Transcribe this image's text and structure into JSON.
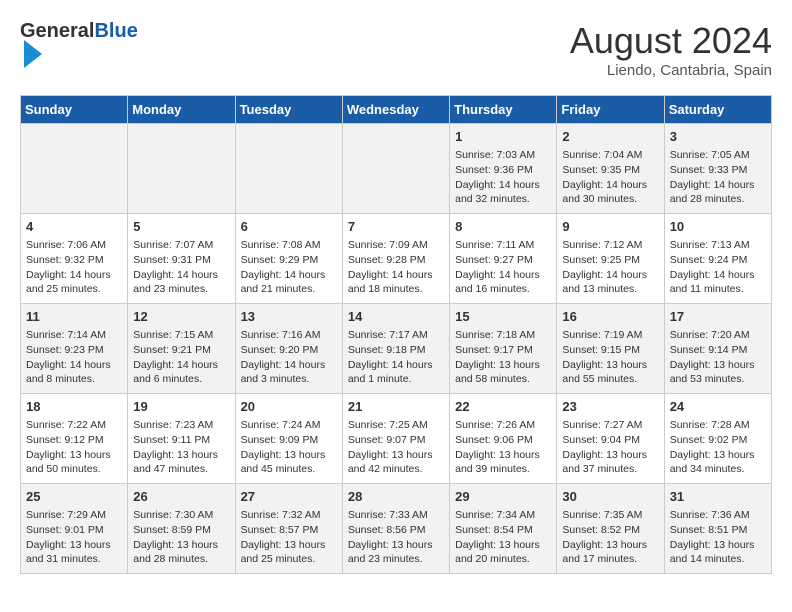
{
  "logo": {
    "general": "General",
    "blue": "Blue"
  },
  "title": "August 2024",
  "location": "Liendo, Cantabria, Spain",
  "days_of_week": [
    "Sunday",
    "Monday",
    "Tuesday",
    "Wednesday",
    "Thursday",
    "Friday",
    "Saturday"
  ],
  "weeks": [
    [
      {
        "day": "",
        "info": ""
      },
      {
        "day": "",
        "info": ""
      },
      {
        "day": "",
        "info": ""
      },
      {
        "day": "",
        "info": ""
      },
      {
        "day": "1",
        "info": "Sunrise: 7:03 AM\nSunset: 9:36 PM\nDaylight: 14 hours and 32 minutes."
      },
      {
        "day": "2",
        "info": "Sunrise: 7:04 AM\nSunset: 9:35 PM\nDaylight: 14 hours and 30 minutes."
      },
      {
        "day": "3",
        "info": "Sunrise: 7:05 AM\nSunset: 9:33 PM\nDaylight: 14 hours and 28 minutes."
      }
    ],
    [
      {
        "day": "4",
        "info": "Sunrise: 7:06 AM\nSunset: 9:32 PM\nDaylight: 14 hours and 25 minutes."
      },
      {
        "day": "5",
        "info": "Sunrise: 7:07 AM\nSunset: 9:31 PM\nDaylight: 14 hours and 23 minutes."
      },
      {
        "day": "6",
        "info": "Sunrise: 7:08 AM\nSunset: 9:29 PM\nDaylight: 14 hours and 21 minutes."
      },
      {
        "day": "7",
        "info": "Sunrise: 7:09 AM\nSunset: 9:28 PM\nDaylight: 14 hours and 18 minutes."
      },
      {
        "day": "8",
        "info": "Sunrise: 7:11 AM\nSunset: 9:27 PM\nDaylight: 14 hours and 16 minutes."
      },
      {
        "day": "9",
        "info": "Sunrise: 7:12 AM\nSunset: 9:25 PM\nDaylight: 14 hours and 13 minutes."
      },
      {
        "day": "10",
        "info": "Sunrise: 7:13 AM\nSunset: 9:24 PM\nDaylight: 14 hours and 11 minutes."
      }
    ],
    [
      {
        "day": "11",
        "info": "Sunrise: 7:14 AM\nSunset: 9:23 PM\nDaylight: 14 hours and 8 minutes."
      },
      {
        "day": "12",
        "info": "Sunrise: 7:15 AM\nSunset: 9:21 PM\nDaylight: 14 hours and 6 minutes."
      },
      {
        "day": "13",
        "info": "Sunrise: 7:16 AM\nSunset: 9:20 PM\nDaylight: 14 hours and 3 minutes."
      },
      {
        "day": "14",
        "info": "Sunrise: 7:17 AM\nSunset: 9:18 PM\nDaylight: 14 hours and 1 minute."
      },
      {
        "day": "15",
        "info": "Sunrise: 7:18 AM\nSunset: 9:17 PM\nDaylight: 13 hours and 58 minutes."
      },
      {
        "day": "16",
        "info": "Sunrise: 7:19 AM\nSunset: 9:15 PM\nDaylight: 13 hours and 55 minutes."
      },
      {
        "day": "17",
        "info": "Sunrise: 7:20 AM\nSunset: 9:14 PM\nDaylight: 13 hours and 53 minutes."
      }
    ],
    [
      {
        "day": "18",
        "info": "Sunrise: 7:22 AM\nSunset: 9:12 PM\nDaylight: 13 hours and 50 minutes."
      },
      {
        "day": "19",
        "info": "Sunrise: 7:23 AM\nSunset: 9:11 PM\nDaylight: 13 hours and 47 minutes."
      },
      {
        "day": "20",
        "info": "Sunrise: 7:24 AM\nSunset: 9:09 PM\nDaylight: 13 hours and 45 minutes."
      },
      {
        "day": "21",
        "info": "Sunrise: 7:25 AM\nSunset: 9:07 PM\nDaylight: 13 hours and 42 minutes."
      },
      {
        "day": "22",
        "info": "Sunrise: 7:26 AM\nSunset: 9:06 PM\nDaylight: 13 hours and 39 minutes."
      },
      {
        "day": "23",
        "info": "Sunrise: 7:27 AM\nSunset: 9:04 PM\nDaylight: 13 hours and 37 minutes."
      },
      {
        "day": "24",
        "info": "Sunrise: 7:28 AM\nSunset: 9:02 PM\nDaylight: 13 hours and 34 minutes."
      }
    ],
    [
      {
        "day": "25",
        "info": "Sunrise: 7:29 AM\nSunset: 9:01 PM\nDaylight: 13 hours and 31 minutes."
      },
      {
        "day": "26",
        "info": "Sunrise: 7:30 AM\nSunset: 8:59 PM\nDaylight: 13 hours and 28 minutes."
      },
      {
        "day": "27",
        "info": "Sunrise: 7:32 AM\nSunset: 8:57 PM\nDaylight: 13 hours and 25 minutes."
      },
      {
        "day": "28",
        "info": "Sunrise: 7:33 AM\nSunset: 8:56 PM\nDaylight: 13 hours and 23 minutes."
      },
      {
        "day": "29",
        "info": "Sunrise: 7:34 AM\nSunset: 8:54 PM\nDaylight: 13 hours and 20 minutes."
      },
      {
        "day": "30",
        "info": "Sunrise: 7:35 AM\nSunset: 8:52 PM\nDaylight: 13 hours and 17 minutes."
      },
      {
        "day": "31",
        "info": "Sunrise: 7:36 AM\nSunset: 8:51 PM\nDaylight: 13 hours and 14 minutes."
      }
    ]
  ]
}
